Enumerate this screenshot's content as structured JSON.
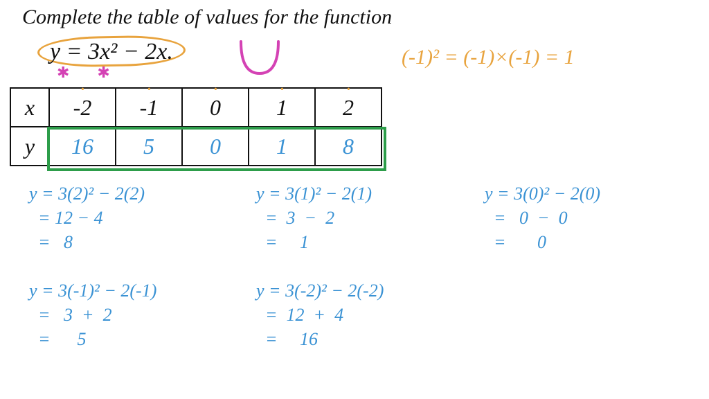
{
  "title": "Complete the table of values for the function",
  "equation": "y = 3x² − 2x.",
  "asterisks": "✱✱",
  "side_note": "(-1)² = (-1)×(-1) = 1",
  "table": {
    "x_label": "x",
    "y_label": "y",
    "x": [
      "-2",
      "-1",
      "0",
      "1",
      "2"
    ],
    "y": [
      "16",
      "5",
      "0",
      "1",
      "8"
    ]
  },
  "u_svg_stroke": "#d442b4",
  "work": {
    "w1": {
      "l1": "y = 3(2)² − 2(2)",
      "l2": "  = 12 − 4",
      "l3": "  =   8"
    },
    "w2": {
      "l1": "y = 3(1)² − 2(1)",
      "l2": "  =  3  −  2",
      "l3": "  =     1"
    },
    "w3": {
      "l1": "y = 3(0)² − 2(0)",
      "l2": "  =   0  −  0",
      "l3": "  =       0"
    },
    "w4": {
      "l1": "y = 3(-1)² − 2(-1)",
      "l2": "  =   3  +  2",
      "l3": "  =      5"
    },
    "w5": {
      "l1": "y = 3(-2)² − 2(-2)",
      "l2": "  =  12  +  4",
      "l3": "  =     16"
    }
  },
  "chart_data": {
    "type": "table",
    "title": "Table of values for y = 3x² − 2x",
    "columns": [
      "x",
      "y"
    ],
    "rows": [
      {
        "x": -2,
        "y": 16
      },
      {
        "x": -1,
        "y": 5
      },
      {
        "x": 0,
        "y": 0
      },
      {
        "x": 1,
        "y": 1
      },
      {
        "x": 2,
        "y": 8
      }
    ],
    "function": "y = 3x^2 - 2x"
  }
}
